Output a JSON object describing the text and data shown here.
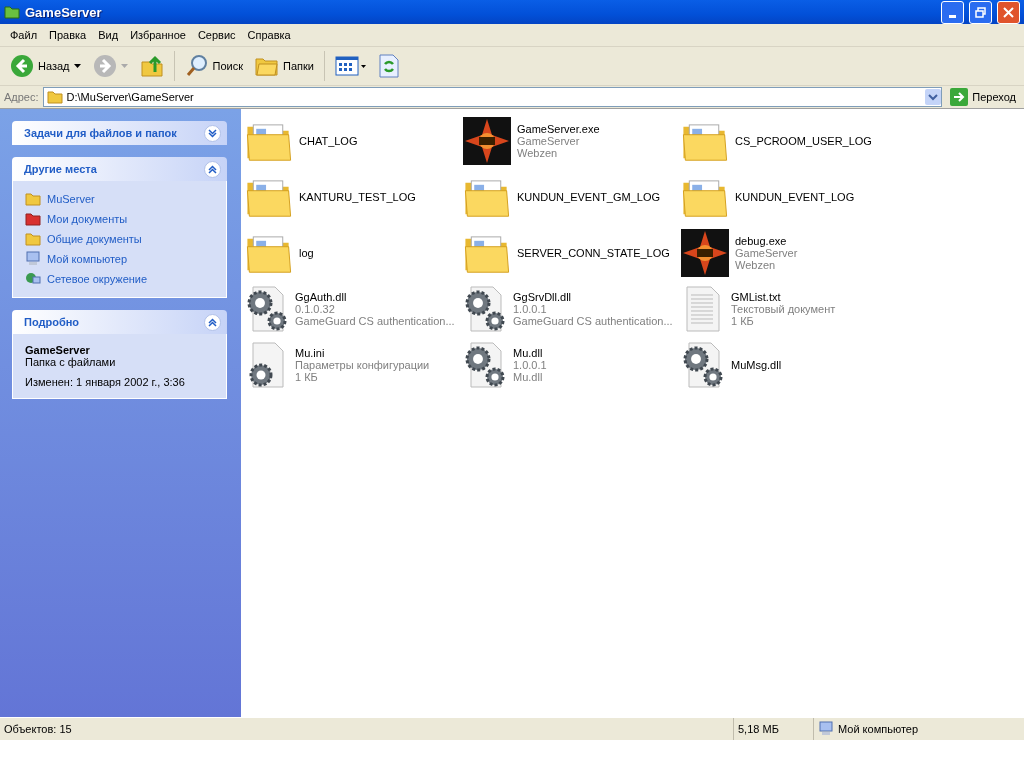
{
  "window": {
    "title": "GameServer"
  },
  "menu": [
    "Файл",
    "Правка",
    "Вид",
    "Избранное",
    "Сервис",
    "Справка"
  ],
  "toolbar": [
    {
      "kind": "back",
      "label": "Назад",
      "disabled": false
    },
    {
      "kind": "forward",
      "disabled": true
    },
    {
      "kind": "up"
    },
    {
      "kind": "search",
      "label": "Поиск"
    },
    {
      "kind": "folders",
      "label": "Папки"
    },
    {
      "kind": "views"
    },
    {
      "kind": "sync"
    }
  ],
  "address": {
    "label": "Адрес:",
    "value": "D:\\MuServer\\GameServer",
    "go": "Переход"
  },
  "sidebar": [
    {
      "title": "Задачи для файлов и папок",
      "expanded": false
    },
    {
      "title": "Другие места",
      "expanded": true,
      "items": [
        {
          "label": "MuServer"
        },
        {
          "label": "Мои документы"
        },
        {
          "label": "Общие документы"
        },
        {
          "label": "Мой компьютер"
        },
        {
          "label": "Сетевое окружение"
        }
      ]
    },
    {
      "title": "Подробно",
      "expanded": true,
      "name": "GameServer",
      "type": "Папка с файлами",
      "modified": "Изменен: 1 января 2002 г., 3:36"
    }
  ],
  "files": [
    {
      "kind": "folder",
      "name": "CHAT_LOG"
    },
    {
      "kind": "exe",
      "name": "GameServer.exe",
      "details": [
        "GameServer",
        "Webzen"
      ]
    },
    {
      "kind": "folder",
      "name": "CS_PCROOM_USER_LOG"
    },
    {
      "kind": "folder",
      "name": "KANTURU_TEST_LOG"
    },
    {
      "kind": "folder",
      "name": "KUNDUN_EVENT_GM_LOG"
    },
    {
      "kind": "folder",
      "name": "KUNDUN_EVENT_LOG"
    },
    {
      "kind": "folder",
      "name": "log"
    },
    {
      "kind": "folder",
      "name": "SERVER_CONN_STATE_LOG"
    },
    {
      "kind": "exe",
      "name": "debug.exe",
      "details": [
        "GameServer",
        "Webzen"
      ]
    },
    {
      "kind": "dll",
      "name": "GgAuth.dll",
      "details": [
        "0.1.0.32",
        "GameGuard CS authentication..."
      ]
    },
    {
      "kind": "dll",
      "name": "GgSrvDll.dll",
      "details": [
        "1.0.0.1",
        "GameGuard CS authentication..."
      ]
    },
    {
      "kind": "txt",
      "name": "GMList.txt",
      "details": [
        "Текстовый документ",
        "1 КБ"
      ]
    },
    {
      "kind": "ini",
      "name": "Mu.ini",
      "details": [
        "Параметры конфигурации",
        "1 КБ"
      ]
    },
    {
      "kind": "dll",
      "name": "Mu.dll",
      "details": [
        "1.0.0.1",
        "Mu.dll"
      ]
    },
    {
      "kind": "dll",
      "name": "MuMsg.dll"
    }
  ],
  "status_bar": {
    "objects": "Объектов: 15",
    "size": "5,18 МБ",
    "zone": "Мой компьютер"
  }
}
